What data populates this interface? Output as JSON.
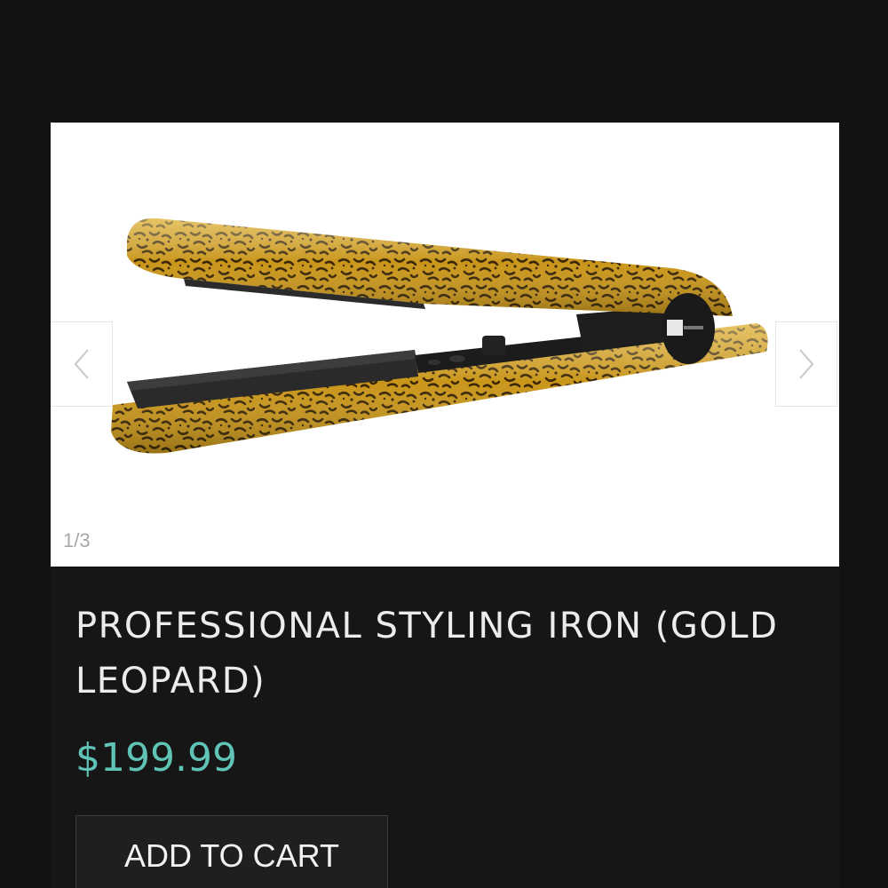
{
  "gallery": {
    "image_alt": "Gold leopard print professional styling iron",
    "counter": "1/3",
    "prev_icon": "chevron-left-icon",
    "next_icon": "chevron-right-icon"
  },
  "product": {
    "title": "PROFESSIONAL STYLING IRON (GOLD LEOPARD)",
    "price": "$199.99",
    "add_to_cart_label": "ADD TO CART"
  },
  "colors": {
    "page_background": "#121212",
    "card_background": "#161616",
    "price": "#5fc3b5",
    "title": "#ececec",
    "product_gold": "#c9961a"
  }
}
